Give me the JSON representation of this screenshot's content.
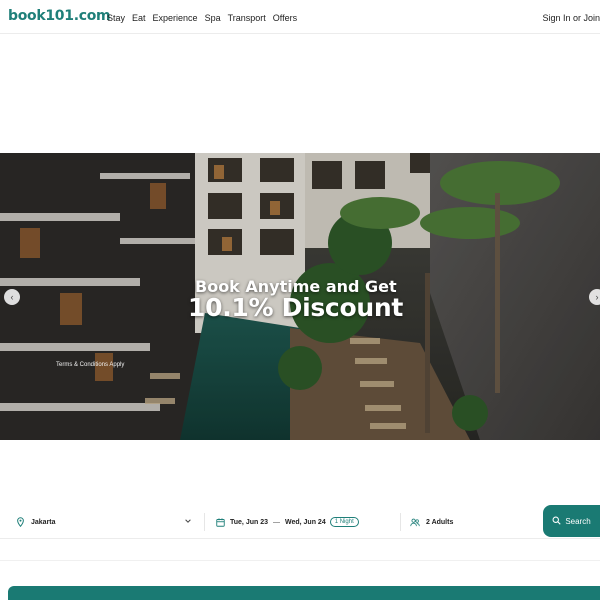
{
  "header": {
    "logo": "book101.com",
    "nav": [
      "Stay",
      "Eat",
      "Experience",
      "Spa",
      "Transport",
      "Offers"
    ],
    "signin": "Sign In or Join"
  },
  "hero": {
    "line1": "Book Anytime and Get",
    "line2": "10.1% Discount",
    "terms": "Terms & Conditions Apply",
    "prev_icon": "chevron-left-icon",
    "next_icon": "chevron-right-icon"
  },
  "search": {
    "location": "Jakarta",
    "location_icon": "location-pin-icon",
    "checkin": "Tue, Jun 23",
    "checkout": "Wed, Jun 24",
    "separator": "—",
    "nights": "1 Night",
    "calendar_icon": "calendar-icon",
    "guests": "2 Adults",
    "guests_icon": "users-icon",
    "button_label": "Search",
    "button_icon": "search-icon"
  },
  "colors": {
    "brand": "#1f7f79",
    "button": "#1a7a73"
  }
}
